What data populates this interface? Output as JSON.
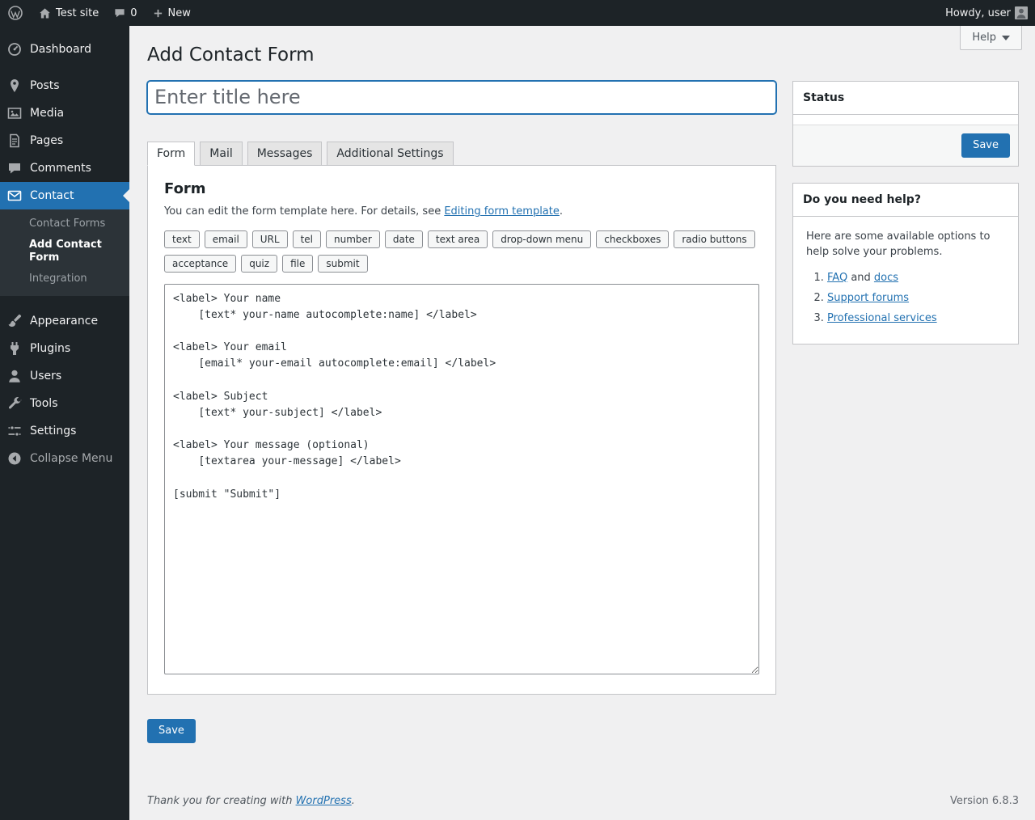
{
  "admin_bar": {
    "site_name": "Test site",
    "comments_count": "0",
    "new_label": "New",
    "howdy_text": "Howdy, user"
  },
  "sidebar": {
    "items": [
      {
        "label": "Dashboard"
      },
      {
        "label": "Posts"
      },
      {
        "label": "Media"
      },
      {
        "label": "Pages"
      },
      {
        "label": "Comments"
      },
      {
        "label": "Contact"
      },
      {
        "label": "Appearance"
      },
      {
        "label": "Plugins"
      },
      {
        "label": "Users"
      },
      {
        "label": "Tools"
      },
      {
        "label": "Settings"
      },
      {
        "label": "Collapse Menu"
      }
    ],
    "contact_submenu": [
      {
        "label": "Contact Forms"
      },
      {
        "label": "Add Contact Form"
      },
      {
        "label": "Integration"
      }
    ]
  },
  "header": {
    "page_title": "Add Contact Form",
    "help_label": "Help"
  },
  "editor": {
    "title_placeholder": "Enter title here",
    "tabs": [
      {
        "label": "Form"
      },
      {
        "label": "Mail"
      },
      {
        "label": "Messages"
      },
      {
        "label": "Additional Settings"
      }
    ],
    "panel_heading": "Form",
    "description": {
      "prefix": "You can edit the form template here. For details, see ",
      "link": "Editing form template",
      "suffix": "."
    },
    "tag_buttons": [
      "text",
      "email",
      "URL",
      "tel",
      "number",
      "date",
      "text area",
      "drop-down menu",
      "checkboxes",
      "radio buttons",
      "acceptance",
      "quiz",
      "file",
      "submit"
    ],
    "template_code": "<label> Your name\n    [text* your-name autocomplete:name] </label>\n\n<label> Your email\n    [email* your-email autocomplete:email] </label>\n\n<label> Subject\n    [text* your-subject] </label>\n\n<label> Your message (optional)\n    [textarea your-message] </label>\n\n[submit \"Submit\"]",
    "save_label": "Save"
  },
  "status_box": {
    "title": "Status",
    "save_label": "Save"
  },
  "help_box": {
    "title": "Do you need help?",
    "intro": "Here are some available options to help solve your problems.",
    "item1": {
      "link_a": "FAQ",
      "connector": " and ",
      "link_b": "docs"
    },
    "item2": {
      "link": "Support forums"
    },
    "item3": {
      "link": "Professional services"
    }
  },
  "footer": {
    "thanks_prefix": "Thank you for creating with ",
    "wordpress_link": "WordPress",
    "thanks_suffix": ".",
    "version": "Version 6.8.3"
  }
}
